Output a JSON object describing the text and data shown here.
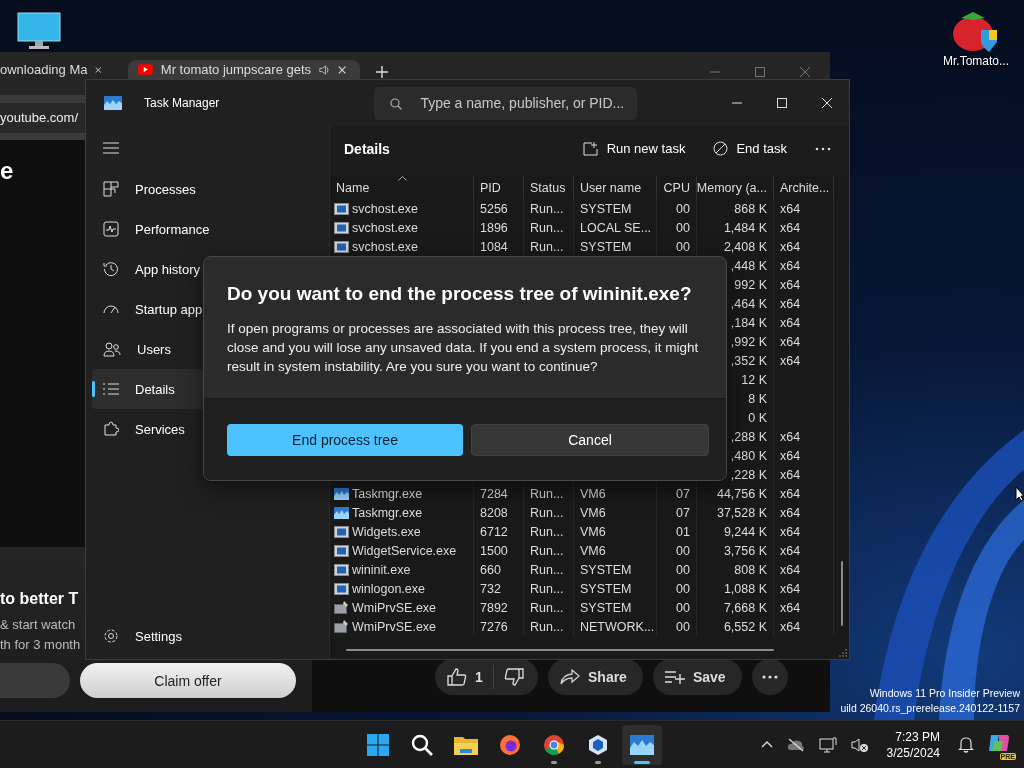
{
  "desktop": {
    "shortcuts": [
      {
        "label": "Mr.Tomato..."
      }
    ],
    "build_info": [
      "Windows 11 Pro Insider Preview",
      "uild 26040.rs_prerelease.240122-1157"
    ]
  },
  "browser": {
    "tabs": [
      {
        "title": "ownloading Ma",
        "selected": false,
        "audio": false
      },
      {
        "title": "Mr tomato jumpscare gets",
        "selected": true,
        "audio": true
      }
    ],
    "address": "youtube.com/",
    "heading": "e",
    "promo": {
      "title": "to better T",
      "text_lines": [
        "& start watch",
        "th for 3 month"
      ],
      "button": "Claim offer"
    },
    "video_actions": {
      "likes": "1",
      "share": "Share",
      "save": "Save"
    }
  },
  "task_manager": {
    "title": "Task Manager",
    "search_placeholder": "Type a name, publisher, or PID...",
    "nav": [
      {
        "kind": "processes",
        "label": "Processes",
        "selected": false
      },
      {
        "kind": "performance",
        "label": "Performance",
        "selected": false
      },
      {
        "kind": "history",
        "label": "App history",
        "selected": false
      },
      {
        "kind": "startup",
        "label": "Startup app",
        "selected": false
      },
      {
        "kind": "users",
        "label": "Users",
        "selected": false
      },
      {
        "kind": "details",
        "label": "Details",
        "selected": true
      },
      {
        "kind": "services",
        "label": "Services",
        "selected": false
      }
    ],
    "settings": "Settings",
    "page_title": "Details",
    "commands": [
      {
        "kind": "run",
        "label": "Run new task"
      },
      {
        "kind": "end",
        "label": "End task"
      }
    ],
    "columns": [
      {
        "label": "Name",
        "sorted": true
      },
      {
        "label": "PID",
        "sorted": false
      },
      {
        "label": "Status",
        "sorted": false
      },
      {
        "label": "User name",
        "sorted": false
      },
      {
        "label": "CPU",
        "sorted": false
      },
      {
        "label": "Memory (a...",
        "sorted": false
      },
      {
        "label": "Archite...",
        "sorted": false
      }
    ],
    "rows": [
      {
        "kind": "window",
        "name": "svchost.exe",
        "pid": "5256",
        "status": "Run...",
        "user": "SYSTEM",
        "cpu": "00",
        "memory": "868 K",
        "arch": "x64"
      },
      {
        "kind": "window",
        "name": "svchost.exe",
        "pid": "1896",
        "status": "Run...",
        "user": "LOCAL SE...",
        "cpu": "00",
        "memory": "1,484 K",
        "arch": "x64"
      },
      {
        "kind": "window",
        "name": "svchost.exe",
        "pid": "1084",
        "status": "Run...",
        "user": "SYSTEM",
        "cpu": "00",
        "memory": "2,408 K",
        "arch": "x64"
      },
      {
        "memory": ",448 K",
        "arch": "x64"
      },
      {
        "memory": "992 K",
        "arch": "x64"
      },
      {
        "memory": ",464 K",
        "arch": "x64"
      },
      {
        "memory": ",184 K",
        "arch": "x64"
      },
      {
        "memory": ",992 K",
        "arch": "x64"
      },
      {
        "memory": ",352 K",
        "arch": "x64"
      },
      {
        "memory": "12 K"
      },
      {
        "memory": "8 K"
      },
      {
        "memory": "0 K"
      },
      {
        "memory": ",288 K",
        "arch": "x64"
      },
      {
        "memory": ",480 K",
        "arch": "x64"
      },
      {
        "memory": ",228 K",
        "arch": "x64"
      },
      {
        "kind": "taskmgr",
        "name": "Taskmgr.exe",
        "pid": "7284",
        "status": "Run...",
        "user": "VM6",
        "cpu": "07",
        "memory": "44,756 K",
        "arch": "x64"
      },
      {
        "kind": "taskmgr",
        "name": "Taskmgr.exe",
        "pid": "8208",
        "status": "Run...",
        "user": "VM6",
        "cpu": "07",
        "memory": "37,528 K",
        "arch": "x64"
      },
      {
        "kind": "window",
        "name": "Widgets.exe",
        "pid": "6712",
        "status": "Run...",
        "user": "VM6",
        "cpu": "01",
        "memory": "9,244 K",
        "arch": "x64"
      },
      {
        "kind": "window",
        "name": "WidgetService.exe",
        "pid": "1500",
        "status": "Run...",
        "user": "VM6",
        "cpu": "00",
        "memory": "3,756 K",
        "arch": "x64"
      },
      {
        "kind": "window",
        "name": "wininit.exe",
        "pid": "660",
        "status": "Run...",
        "user": "SYSTEM",
        "cpu": "00",
        "memory": "808 K",
        "arch": "x64"
      },
      {
        "kind": "window",
        "name": "winlogon.exe",
        "pid": "732",
        "status": "Run...",
        "user": "SYSTEM",
        "cpu": "00",
        "memory": "1,088 K",
        "arch": "x64"
      },
      {
        "kind": "wmi",
        "name": "WmiPrvSE.exe",
        "pid": "7892",
        "status": "Run...",
        "user": "SYSTEM",
        "cpu": "00",
        "memory": "7,668 K",
        "arch": "x64"
      },
      {
        "kind": "wmi",
        "name": "WmiPrvSE.exe",
        "pid": "7276",
        "status": "Run...",
        "user": "NETWORK...",
        "cpu": "00",
        "memory": "6,552 K",
        "arch": "x64"
      }
    ]
  },
  "dialog": {
    "title": "Do you want to end the process tree of wininit.exe?",
    "message": "If open programs or processes are associated with this process tree, they will close and you will lose any unsaved data. If you end a system process, it might result in system instability. Are you sure you want to continue?",
    "primary": "End process tree",
    "secondary": "Cancel"
  },
  "taskbar": {
    "apps": [
      {
        "kind": "start",
        "running": false,
        "selected": false
      },
      {
        "kind": "search",
        "running": false,
        "selected": false
      },
      {
        "kind": "files",
        "running": false,
        "selected": false
      },
      {
        "kind": "firefox",
        "running": false,
        "selected": false
      },
      {
        "kind": "chrome",
        "running": true,
        "selected": false
      },
      {
        "kind": "toolbox",
        "running": true,
        "selected": false
      },
      {
        "kind": "taskmgr",
        "running": true,
        "selected": true
      }
    ],
    "time": "7:23 PM",
    "date": "3/25/2024",
    "badge": "PRE"
  }
}
